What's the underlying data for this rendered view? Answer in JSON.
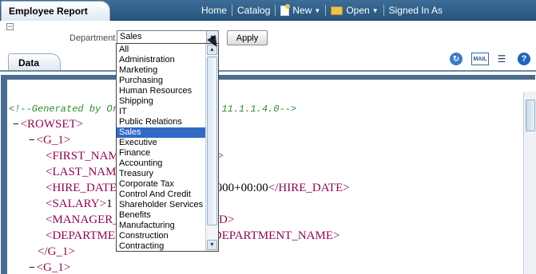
{
  "header": {
    "report_title": "Employee Report",
    "nav": [
      {
        "label": "Home"
      },
      {
        "label": "Catalog"
      },
      {
        "label": "New"
      },
      {
        "label": "Open"
      },
      {
        "label": "Signed In As"
      }
    ]
  },
  "parameters": {
    "label": "Department",
    "selected_value": "Sales",
    "apply_label": "Apply",
    "collapse_symbol": "−"
  },
  "tabs": {
    "data_label": "Data"
  },
  "dropdown": {
    "options": [
      "All",
      "Administration",
      "Marketing",
      "Purchasing",
      "Human Resources",
      "Shipping",
      "IT",
      "Public Relations",
      "Sales",
      "Executive",
      "Finance",
      "Accounting",
      "Treasury",
      "Corporate Tax",
      "Control And Credit",
      "Shareholder Services",
      "Benefits",
      "Manufacturing",
      "Construction",
      "Contracting"
    ],
    "selected_index": 8
  },
  "xml": {
    "comment": "<!--Generated by Oracle BI Publisher 11.1.1.4.0-->",
    "rowset_open": "<ROWSET>",
    "g1_open": "<G_1>",
    "g1_close": "</G_1>",
    "first_name_line": "<FIRST_NAME></FIRST_NAME>",
    "last_name_line": "<LAST_NAME></LAST_NAME>",
    "hire_date_open": "<HIRE_DATE>",
    "hire_date_value": "00:00.000+00:00",
    "hire_date_close": "</HIRE_DATE>",
    "salary_open": "<SALARY>",
    "salary_value": "1",
    "manager_line": "<MANAGER_ID></MANAGER_ID>",
    "dept_open": "<DEPARTMENT_NAME>",
    "dept_close": "</DEPARTMENT_NAME>",
    "toggle_symbol": "−"
  },
  "colors": {
    "header_blue": "#2f5f89",
    "xml_tag": "#8b0a52",
    "xml_comment": "#2e8b2e",
    "selection": "#316ac5"
  },
  "icons": [
    "new-document-icon",
    "open-folder-icon",
    "refresh-icon",
    "email-icon",
    "menu-icon",
    "help-icon"
  ]
}
